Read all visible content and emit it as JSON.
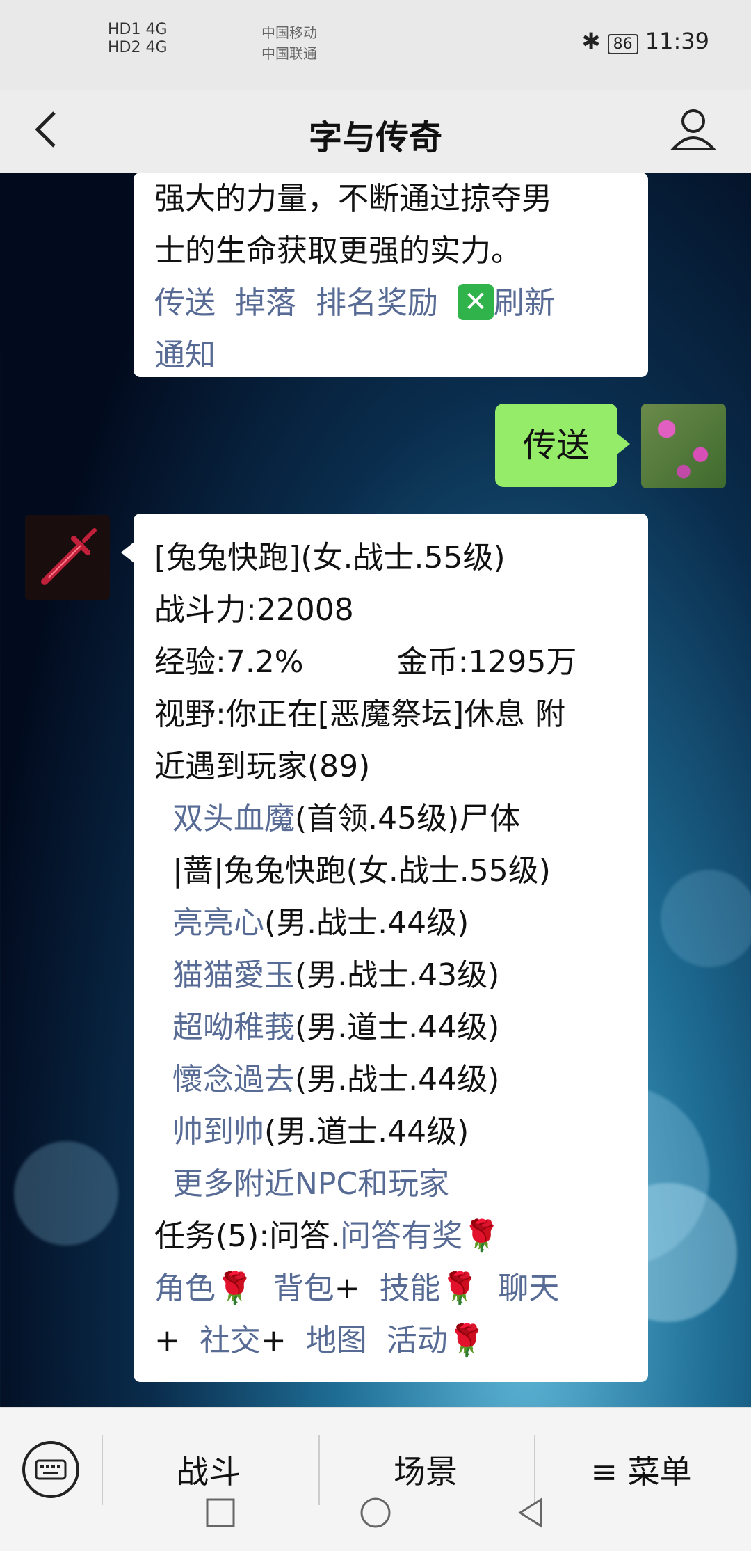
{
  "status_bar": {
    "sim1": "HD1 4G",
    "sim2": "HD2 4G",
    "carrier1": "中国移动",
    "carrier2": "中国联通",
    "battery": "86",
    "time": "11:39"
  },
  "header": {
    "title": "字与传奇"
  },
  "messages": {
    "top": {
      "line1": "强大的力量，不断通过掠夺男",
      "line2": "士的生命获取更强的实力。",
      "links": [
        "传送",
        "掉落",
        "排名奖励"
      ],
      "refresh": "刷新",
      "notify": "通知"
    },
    "me": {
      "text": "传送"
    },
    "main": {
      "line_name": "[兔兔快跑](女.战士.55级)",
      "line_power": "战斗力:22008",
      "exp": "经验:7.2%",
      "gold": "金币:1295万",
      "view1": "视野:你正在[恶魔祭坛]休息 附",
      "view2": "近遇到玩家(89)",
      "nearby": [
        {
          "link": "双头血魔",
          "info": "(首领.45级)尸体"
        },
        {
          "link": "",
          "info": "|蔷|兔兔快跑(女.战士.55级)"
        },
        {
          "link": "亮亮心",
          "info": "(男.战士.44级)"
        },
        {
          "link": "猫猫愛玉",
          "info": "(男.战士.43级)"
        },
        {
          "link": "超呦稚莪",
          "info": "(男.道士.44级)"
        },
        {
          "link": "懷念過去",
          "info": "(男.战士.44级)"
        },
        {
          "link": "帅到帅",
          "info": "(男.道士.44级)"
        }
      ],
      "more": "更多附近NPC和玩家",
      "task_prefix": "任务(5):问答.",
      "task_link": "问答有奖",
      "menu_role": "角色",
      "menu_bag": "背包",
      "menu_skill": "技能",
      "menu_chat": "聊天",
      "menu_social": "社交",
      "menu_map": "地图",
      "menu_activity": "活动",
      "plus": "+",
      "rose": "🌹"
    }
  },
  "bottom_menu": {
    "items": [
      "战斗",
      "场景",
      "≡ 菜单"
    ]
  }
}
